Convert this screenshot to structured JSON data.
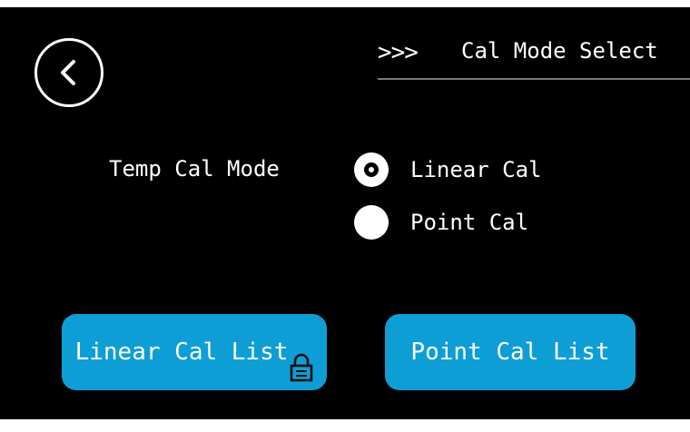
{
  "header": {
    "title_prefix": ">>>",
    "title": "Cal Mode Select"
  },
  "temp_cal": {
    "label": "Temp Cal Mode",
    "options": [
      {
        "label": "Linear Cal",
        "selected": true
      },
      {
        "label": "Point Cal",
        "selected": false
      }
    ]
  },
  "buttons": {
    "linear_cal_list": "Linear Cal List",
    "point_cal_list": "Point Cal List"
  },
  "icons": {
    "back": "back-arrow-icon",
    "lock": "lock-icon"
  },
  "colors": {
    "background": "#000000",
    "button": "#0e9ed6",
    "text": "#ffffff"
  }
}
